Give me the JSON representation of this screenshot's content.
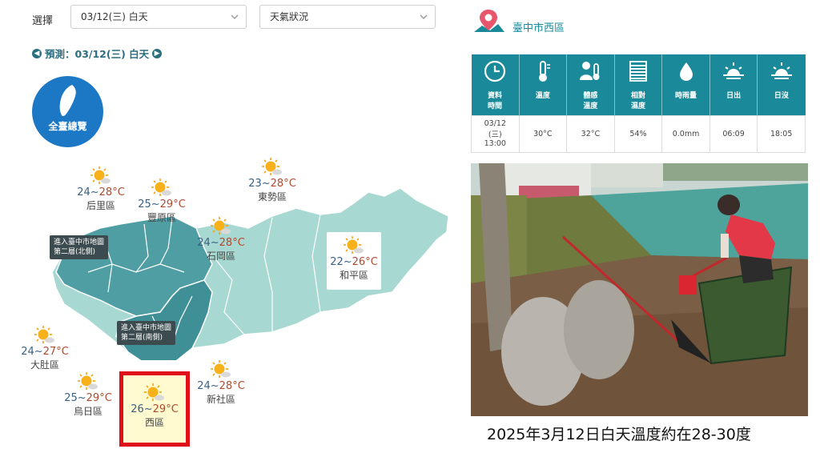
{
  "filters": {
    "label": "選擇",
    "date_value": "03/12(三) 白天",
    "type_value": "天氣狀況"
  },
  "forecast_nav": {
    "text": "預測：03/12(三) 白天"
  },
  "overview_button": {
    "label": "全臺總覽"
  },
  "map": {
    "regions": [
      {
        "id": "houli",
        "temp_low": "24",
        "temp_high": "28°C",
        "name": "后里區"
      },
      {
        "id": "fengyuan",
        "temp_low": "25",
        "temp_high": "29°C",
        "name": "豐原區"
      },
      {
        "id": "dongshi",
        "temp_low": "23",
        "temp_high": "28°C",
        "name": "東勢區"
      },
      {
        "id": "shigang",
        "temp_low": "24",
        "temp_high": "28°C",
        "name": "石岡區"
      },
      {
        "id": "heping",
        "temp_low": "22",
        "temp_high": "26°C",
        "name": "和平區"
      },
      {
        "id": "dadu",
        "temp_low": "24",
        "temp_high": "27°C",
        "name": "大肚區"
      },
      {
        "id": "wuri",
        "temp_low": "25",
        "temp_high": "29°C",
        "name": "烏日區"
      },
      {
        "id": "xinshe",
        "temp_low": "24",
        "temp_high": "28°C",
        "name": "新社區"
      },
      {
        "id": "west",
        "temp_low": "26",
        "temp_high": "29°C",
        "name": "西區"
      }
    ],
    "tip_north": [
      "進入臺中市地圖",
      "第二層(北側)"
    ],
    "tip_south": [
      "進入臺中市地圖",
      "第二層(南側)"
    ]
  },
  "location": {
    "name": "臺中市西區",
    "icon": "map-pin-icon"
  },
  "observation": {
    "headers": [
      {
        "line1": "資料",
        "line2": "時間",
        "icon": "clock-icon"
      },
      {
        "line1": "溫度",
        "line2": "",
        "icon": "thermometer-icon"
      },
      {
        "line1": "體感",
        "line2": "溫度",
        "icon": "feels-like-icon"
      },
      {
        "line1": "相對",
        "line2": "濕度",
        "icon": "humidity-icon"
      },
      {
        "line1": "時雨量",
        "line2": "",
        "icon": "raindrop-icon"
      },
      {
        "line1": "日出",
        "line2": "",
        "icon": "sunrise-icon"
      },
      {
        "line1": "日沒",
        "line2": "",
        "icon": "sunset-icon"
      }
    ],
    "values": {
      "time_date": "03/12",
      "time_day": "(三)",
      "time_clock": "13:00",
      "temp": "30°C",
      "feels": "32°C",
      "humidity": "54%",
      "rain": "0.0mm",
      "sunrise": "06:09",
      "sunset": "18:05"
    }
  },
  "caption": "2025年3月12日白天溫度約在28-30度",
  "colors": {
    "teal": "#1a8a9a",
    "map_dark": "#3f8f96",
    "map_light": "#9fd3cf",
    "highlight": "#e0101a",
    "blue_button": "#1c78c4"
  }
}
